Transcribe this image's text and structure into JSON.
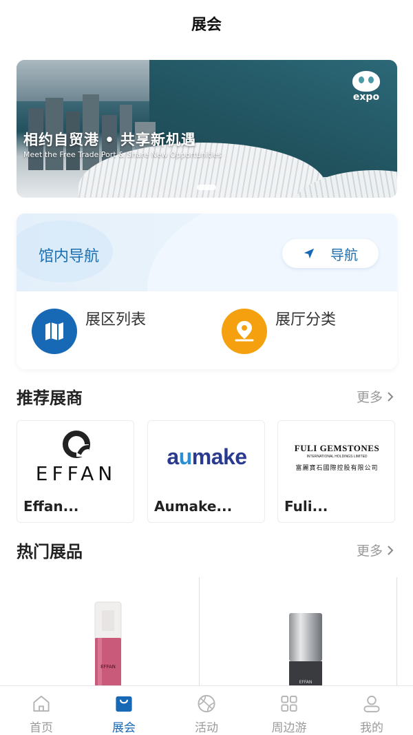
{
  "header": {
    "title": "展会"
  },
  "banner": {
    "headline": "相约自贸港 • 共享新机遇",
    "subtitle": "Meet the Free Trade Port & Share New Opportunities",
    "logo_text": "expo"
  },
  "venue_nav": {
    "title": "馆内导航",
    "button_label": "导航",
    "items": [
      {
        "label": "展区列表",
        "icon": "map-icon",
        "color": "#1769b6"
      },
      {
        "label": "展厅分类",
        "icon": "location-pin-icon",
        "color": "#f5a00e"
      }
    ]
  },
  "recommended_exhibitors": {
    "title": "推荐展商",
    "more": "更多",
    "items": [
      {
        "name": "Effan...",
        "logo_text": "EFFAN"
      },
      {
        "name": "Aumake...",
        "logo_text": "aumake"
      },
      {
        "name": "Fuli...",
        "logo_text": "FULI GEMSTONES",
        "logo_subtext": "INTERNATIONAL HOLDINGS LIMITED",
        "logo_cn": "富麗寶石國際控股有限公司"
      }
    ]
  },
  "hot_products": {
    "title": "热门展品",
    "more": "更多",
    "items": [
      {
        "label_on_product": "EFFAN"
      },
      {
        "label_on_product": "EFFAN"
      }
    ]
  },
  "tabbar": {
    "tabs": [
      {
        "label": "首页",
        "icon": "home-icon",
        "active": false
      },
      {
        "label": "展会",
        "icon": "shopping-bag-icon",
        "active": true
      },
      {
        "label": "活动",
        "icon": "ball-icon",
        "active": false
      },
      {
        "label": "周边游",
        "icon": "grid-icon",
        "active": false
      },
      {
        "label": "我的",
        "icon": "user-icon",
        "active": false
      }
    ]
  },
  "colors": {
    "accent": "#1769b6",
    "orange": "#f5a00e",
    "muted": "#9a9a9a"
  }
}
